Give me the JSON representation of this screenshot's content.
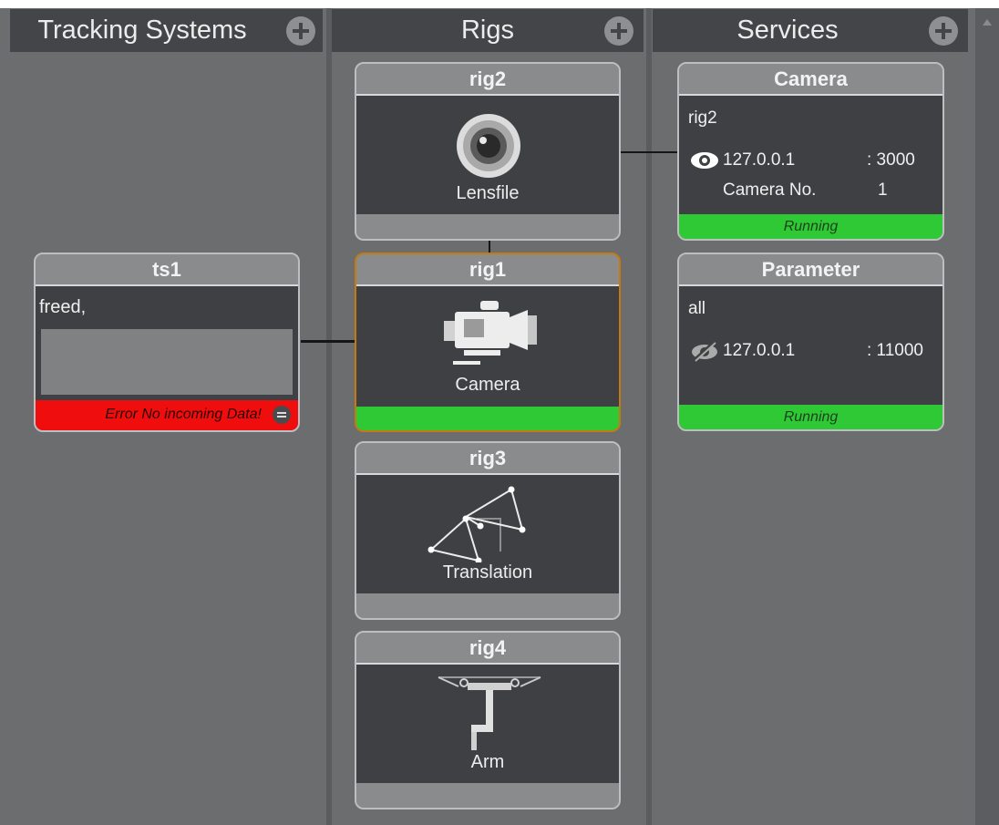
{
  "columns": {
    "tracking": {
      "title": "Tracking Systems"
    },
    "rigs": {
      "title": "Rigs"
    },
    "services": {
      "title": "Services"
    }
  },
  "tracking_systems": [
    {
      "name": "ts1",
      "data": "freed,",
      "status": "Error No incoming Data!",
      "status_color": "#f00d0d"
    }
  ],
  "rigs": [
    {
      "name": "rig2",
      "icon": "lens-icon",
      "label": "Lensfile"
    },
    {
      "name": "rig1",
      "icon": "camera-icon",
      "label": "Camera",
      "selected": true,
      "status_color": "#2ec934"
    },
    {
      "name": "rig3",
      "icon": "translation-icon",
      "label": "Translation"
    },
    {
      "name": "rig4",
      "icon": "arm-icon",
      "label": "Arm"
    }
  ],
  "services": [
    {
      "name": "Camera",
      "target": "rig2",
      "ip": "127.0.0.1",
      "port": ": 3000",
      "extra_label": "Camera No.",
      "extra_value": "1",
      "status": "Running",
      "visibility_icon": "eye-icon"
    },
    {
      "name": "Parameter",
      "target": "all",
      "ip": "127.0.0.1",
      "port": ": 11000",
      "status": "Running",
      "visibility_icon": "eye-slash-icon"
    }
  ],
  "colors": {
    "running": "#2ec934",
    "error": "#f00d0d",
    "selected_border": "#c47a10"
  }
}
